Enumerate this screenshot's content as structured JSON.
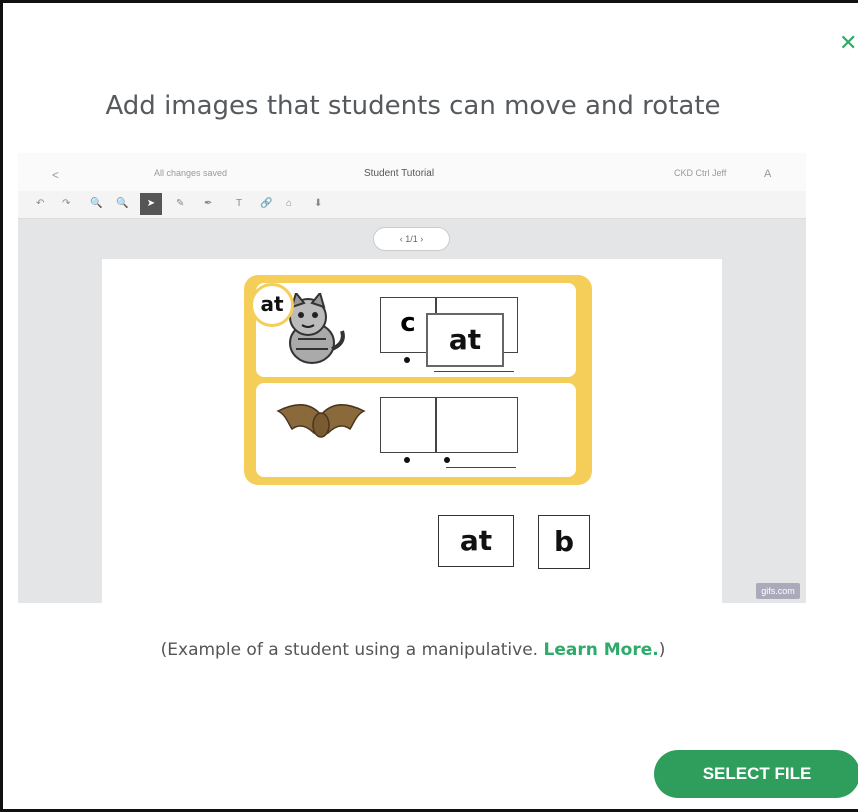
{
  "modal": {
    "close_glyph": "✕",
    "heading": "Add images that students can move and rotate",
    "caption_prefix": "(Example of a student using a manipulative. ",
    "learn_more": "Learn More.",
    "caption_suffix": ")",
    "select_file": "SELECT FILE"
  },
  "preview": {
    "back_glyph": "<",
    "save_status": "All changes saved",
    "doc_title": "Student Tutorial",
    "top_right_text": "CKD Ctrl  Jeff",
    "account_glyph": "A",
    "pager": "‹  1/1  ›",
    "badge_word": "at",
    "box_letter_1": "c",
    "tile_word_1": "at",
    "tile_word_2": "at",
    "tile_letter": "b",
    "watermark": "gifs.com",
    "tools": [
      "↶",
      "↷",
      "🔍",
      "🔍",
      "➤",
      "✎",
      "✒",
      "T",
      "🔗",
      "⌂",
      "⬇"
    ]
  },
  "colors": {
    "accent": "#2f9e5d",
    "card": "#f5ce5a"
  }
}
